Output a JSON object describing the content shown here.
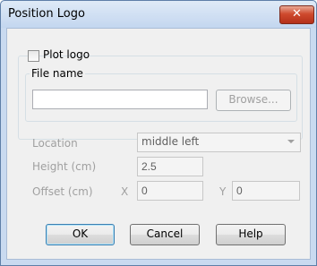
{
  "window": {
    "title": "Position Logo",
    "close_glyph": "✕"
  },
  "plot_logo": {
    "label": "Plot logo",
    "checked": false
  },
  "file": {
    "group_label": "File name",
    "value": "",
    "browse_label": "Browse..."
  },
  "location": {
    "label": "Location",
    "value": "middle left"
  },
  "height": {
    "label": "Height (cm)",
    "value": "2.5"
  },
  "offset": {
    "label": "Offset (cm)",
    "x_label": "X",
    "x_value": "0",
    "y_label": "Y",
    "y_value": "0"
  },
  "buttons": {
    "ok": "OK",
    "cancel": "Cancel",
    "help": "Help"
  }
}
